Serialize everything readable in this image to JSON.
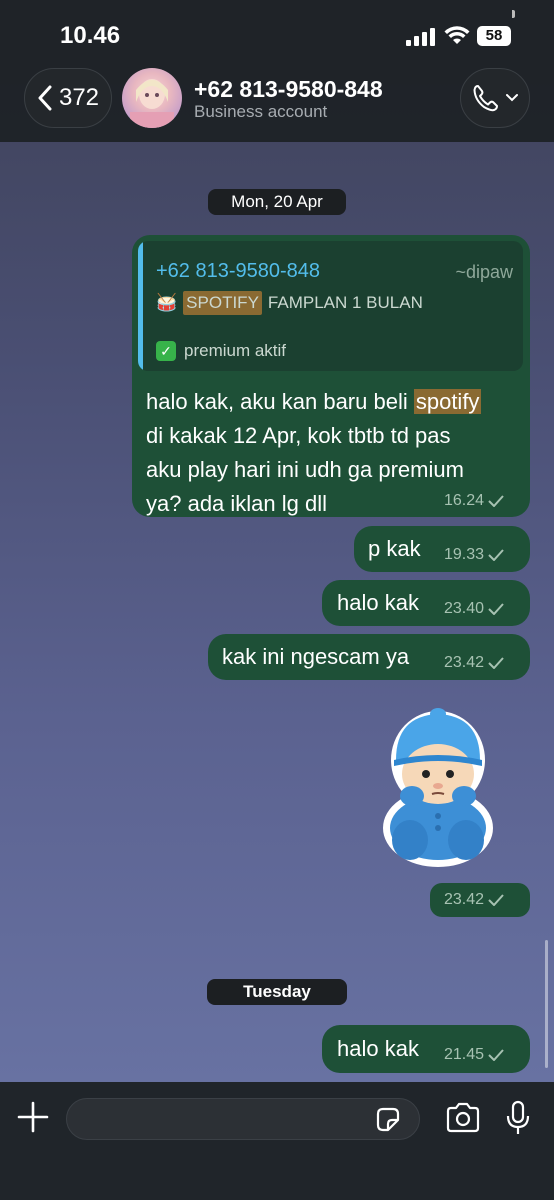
{
  "status_bar": {
    "time": "10.46",
    "battery": "58"
  },
  "header": {
    "back_count": "372",
    "contact_name": "+62 813-9580-848",
    "contact_subtitle": "Business account",
    "icons": [
      "chevron-left-icon",
      "phone-icon",
      "chevron-down-icon"
    ]
  },
  "chat": {
    "date_chip_1": "Mon, 20 Apr",
    "quoted": {
      "author": "+62 813-9580-848",
      "handle": "~dipaw",
      "line1_emoji": "🥁",
      "line1_highlight": "SPOTIFY",
      "line1_rest": "FAMPLAN 1 BULAN",
      "line2": "premium aktif"
    },
    "msg1": {
      "line1_pre": "halo kak, aku kan baru beli ",
      "line1_highlight": "spotify",
      "line2": "di kakak 12 Apr, kok tbtb td pas",
      "line3": "aku play hari ini udh ga premium",
      "line4": "ya? ada iklan lg dll",
      "time": "16.24"
    },
    "msg2": {
      "text": "p kak",
      "time": "19.33"
    },
    "msg3": {
      "text": "halo kak",
      "time": "23.40"
    },
    "msg4": {
      "text": "kak ini ngescam ya",
      "time": "23.42"
    },
    "sticker_msg": {
      "time": "23.42"
    },
    "date_chip_2": "Tuesday",
    "msg5": {
      "text": "halo kak",
      "time": "21.45"
    }
  },
  "composer": {
    "placeholder": ""
  },
  "colors": {
    "bubble": "#1e5037",
    "link": "#53bdeb",
    "highlight": "#8a6a32"
  }
}
